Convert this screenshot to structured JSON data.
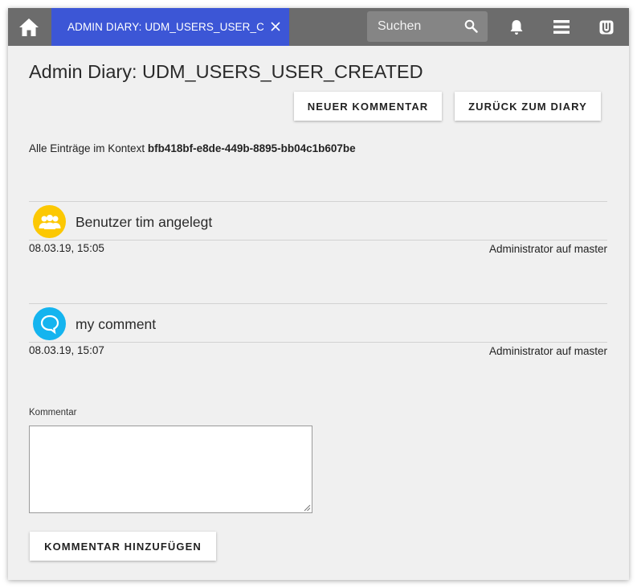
{
  "topbar": {
    "home_icon": "home-icon",
    "tab": {
      "label": "ADMIN DIARY: UDM_USERS_USER_C…",
      "close_icon": "close-icon"
    },
    "search": {
      "placeholder": "Suchen",
      "icon": "search-icon"
    },
    "icons": [
      "bell-icon",
      "menu-icon",
      "univention-logo-icon"
    ]
  },
  "page": {
    "title": "Admin Diary: UDM_USERS_USER_CREATED",
    "buttons": {
      "new_comment": "NEUER KOMMENTAR",
      "back": "ZURÜCK ZUM DIARY"
    },
    "context": {
      "prefix": "Alle Einträge im Kontext ",
      "id": "bfb418bf-e8de-449b-8895-bb04c1b607be"
    }
  },
  "entries": [
    {
      "icon": "users-icon",
      "icon_color": "#fcc803",
      "title": "Benutzer tim angelegt",
      "date": "08.03.19, 15:05",
      "author": "Administrator auf master"
    },
    {
      "icon": "comment-icon",
      "icon_color": "#14b4ef",
      "title": "my comment",
      "date": "08.03.19, 15:07",
      "author": "Administrator auf master"
    }
  ],
  "comment_form": {
    "label": "Kommentar",
    "value": "",
    "submit": "KOMMENTAR HINZUFÜGEN"
  },
  "colors": {
    "accent": "#3c56d6",
    "topbar": "#6c6c6c",
    "background": "#f0f0f0"
  }
}
